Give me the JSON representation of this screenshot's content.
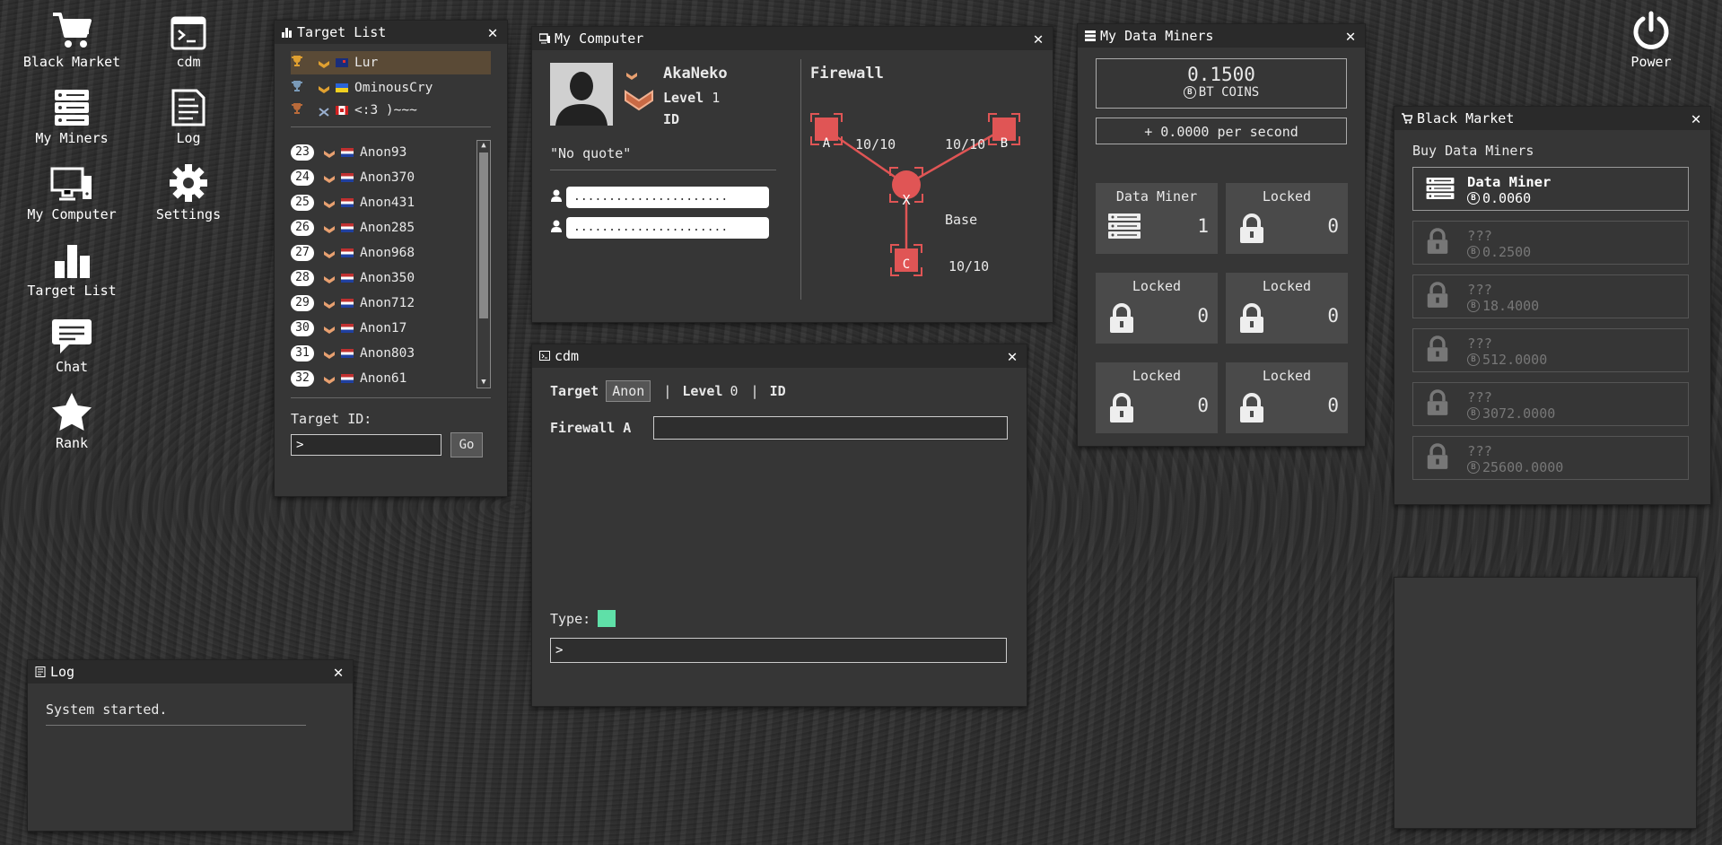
{
  "desktop": {
    "icons": [
      {
        "label": "Black Market",
        "icon": "cart-icon"
      },
      {
        "label": "cdm",
        "icon": "terminal-icon"
      },
      {
        "label": "My Miners",
        "icon": "server-icon"
      },
      {
        "label": "Log",
        "icon": "document-icon"
      },
      {
        "label": "My Computer",
        "icon": "computer-icon"
      },
      {
        "label": "Settings",
        "icon": "gear-icon"
      },
      {
        "label": "Target List",
        "icon": "bar-chart-icon"
      },
      {
        "label": "Chat",
        "icon": "chat-icon"
      },
      {
        "label": "Rank",
        "icon": "star-icon"
      }
    ],
    "power": "Power"
  },
  "target_list": {
    "title": "Target List",
    "top": [
      {
        "name": "Lur",
        "flag": "nz"
      },
      {
        "name": "OminousCry",
        "flag": "ua"
      },
      {
        "name": "<:3 )~~~",
        "flag": "ca"
      }
    ],
    "rows": [
      {
        "rank": "23",
        "name": "Anon93"
      },
      {
        "rank": "24",
        "name": "Anon370"
      },
      {
        "rank": "25",
        "name": "Anon431"
      },
      {
        "rank": "26",
        "name": "Anon285"
      },
      {
        "rank": "27",
        "name": "Anon968"
      },
      {
        "rank": "28",
        "name": "Anon350"
      },
      {
        "rank": "29",
        "name": "Anon712"
      },
      {
        "rank": "30",
        "name": "Anon17"
      },
      {
        "rank": "31",
        "name": "Anon803"
      },
      {
        "rank": "32",
        "name": "Anon61"
      }
    ],
    "target_id_label": "Target ID:",
    "target_id_value": ">",
    "go_label": "Go"
  },
  "my_computer": {
    "title": "My Computer",
    "username": "AkaNeko",
    "level_label": "Level",
    "level_value": "1",
    "id_label": "ID",
    "quote": "\"No quote\"",
    "chat_line": "......................",
    "firewall_title": "Firewall",
    "nodes": {
      "a": {
        "label": "A",
        "value": "10/10"
      },
      "b": {
        "label": "B",
        "value": "10/10"
      },
      "c": {
        "label": "C",
        "value": "10/10"
      },
      "x": {
        "label": "X",
        "value": "Base"
      }
    }
  },
  "cdm": {
    "title": "cdm",
    "target_label": "Target",
    "target_value": "Anon",
    "sep": "|",
    "level_label": "Level",
    "level_value": "0",
    "id_label": "ID",
    "firewall_label": "Firewall A",
    "firewall_input": "",
    "type_label": "Type:",
    "command_value": ">"
  },
  "data_miners": {
    "title": "My Data Miners",
    "coins": "0.1500",
    "coins_label": "BT COINS",
    "rate": "+ 0.0000 per second",
    "cards": [
      {
        "label": "Data Miner",
        "count": "1",
        "locked": false
      },
      {
        "label": "Locked",
        "count": "0",
        "locked": true
      },
      {
        "label": "Locked",
        "count": "0",
        "locked": true
      },
      {
        "label": "Locked",
        "count": "0",
        "locked": true
      },
      {
        "label": "Locked",
        "count": "0",
        "locked": true
      },
      {
        "label": "Locked",
        "count": "0",
        "locked": true
      }
    ]
  },
  "black_market": {
    "title": "Black Market",
    "subtitle": "Buy Data Miners",
    "items": [
      {
        "name": "Data Miner",
        "price": "0.0060",
        "locked": false
      },
      {
        "name": "???",
        "price": "0.2500",
        "locked": true
      },
      {
        "name": "???",
        "price": "18.4000",
        "locked": true
      },
      {
        "name": "???",
        "price": "512.0000",
        "locked": true
      },
      {
        "name": "???",
        "price": "3072.0000",
        "locked": true
      },
      {
        "name": "???",
        "price": "25600.0000",
        "locked": true
      }
    ]
  },
  "log": {
    "title": "Log",
    "entries": [
      "System started."
    ]
  },
  "colors": {
    "accent_red": "#e05555",
    "type_swatch": "#5fe0a8",
    "gold": "#e0a030",
    "silver": "#7a9ab8",
    "bronze": "#b86a3a"
  }
}
